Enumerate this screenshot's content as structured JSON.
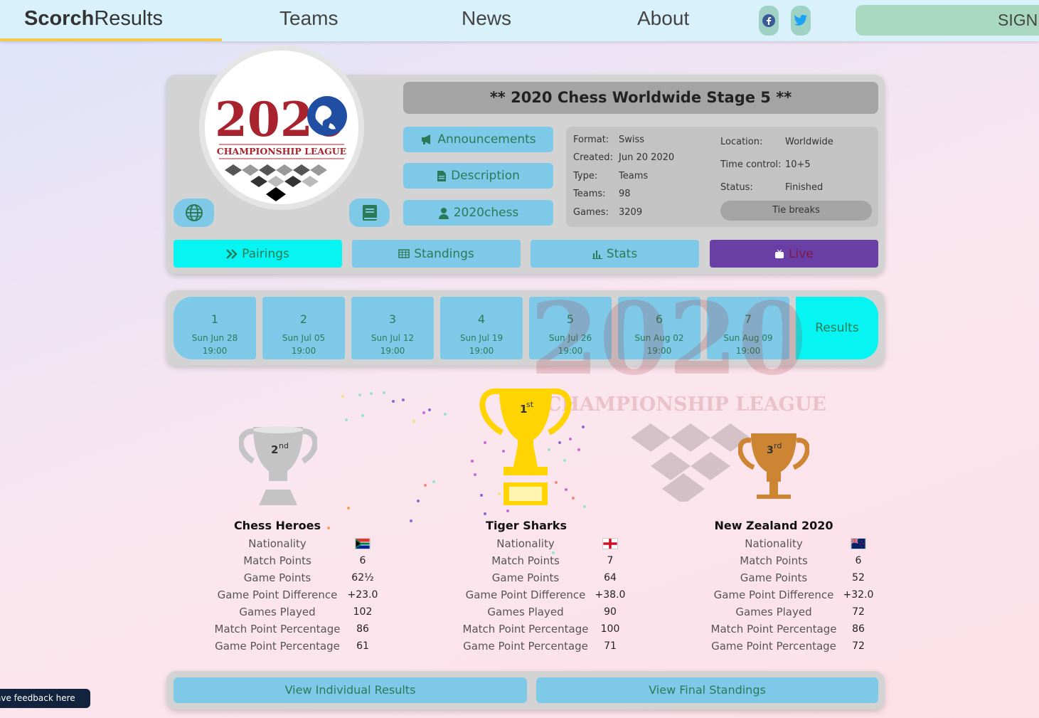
{
  "nav": {
    "brand_bold": "Scorch",
    "brand_light": "Results",
    "links": [
      "Teams",
      "News",
      "About"
    ],
    "signin": "SIGN"
  },
  "tournament": {
    "title": "** 2020 Chess Worldwide Stage 5 **",
    "logo_year": "2020",
    "logo_text": "CHAMPIONSHIP LEAGUE",
    "buttons": {
      "announcements": "Announcements",
      "description": "Description",
      "organizer": "2020chess"
    },
    "info_left": [
      {
        "label": "Format:",
        "value": "Swiss"
      },
      {
        "label": "Created:",
        "value": "Jun 20 2020"
      },
      {
        "label": "Type:",
        "value": "Teams"
      },
      {
        "label": "Teams:",
        "value": "98"
      },
      {
        "label": "Games:",
        "value": "3209"
      }
    ],
    "info_right": [
      {
        "label": "Location:",
        "value": "Worldwide"
      },
      {
        "label": "Time control:",
        "value": "10+5"
      },
      {
        "label": "Status:",
        "value": "Finished"
      }
    ],
    "tie_breaks": "Tie breaks"
  },
  "tabs": {
    "pairings": "Pairings",
    "standings": "Standings",
    "stats": "Stats",
    "live": "Live"
  },
  "rounds": [
    {
      "num": "1",
      "date": "Sun Jun 28",
      "time": "19:00"
    },
    {
      "num": "2",
      "date": "Sun Jul 05",
      "time": "19:00"
    },
    {
      "num": "3",
      "date": "Sun Jul 12",
      "time": "19:00"
    },
    {
      "num": "4",
      "date": "Sun Jul 19",
      "time": "19:00"
    },
    {
      "num": "5",
      "date": "Sun Jul 26",
      "time": "19:00"
    },
    {
      "num": "6",
      "date": "Sun Aug 02",
      "time": "19:00"
    },
    {
      "num": "7",
      "date": "Sun Aug 09",
      "time": "19:00"
    }
  ],
  "results_label": "Results",
  "stat_labels": [
    "Nationality",
    "Match Points",
    "Game Points",
    "Game Point Difference",
    "Games Played",
    "Match Point Percentage",
    "Game Point Percentage"
  ],
  "podium": {
    "second": {
      "place": "2",
      "suffix": "nd",
      "name": "Chess Heroes",
      "stats": [
        "6",
        "62½",
        "+23.0",
        "102",
        "86",
        "61"
      ]
    },
    "first": {
      "place": "1",
      "suffix": "st",
      "name": "Tiger Sharks",
      "stats": [
        "7",
        "64",
        "+38.0",
        "90",
        "100",
        "71"
      ]
    },
    "third": {
      "place": "3",
      "suffix": "rd",
      "name": "New Zealand 2020",
      "stats": [
        "6",
        "52",
        "+32.0",
        "72",
        "86",
        "72"
      ]
    }
  },
  "colors": {
    "gold": "#ffd400",
    "silver": "#c4c4c4",
    "bronze": "#cd8534",
    "accent_cyan": "#06f5f2",
    "button_blue": "#7ec9e8",
    "live_purple": "#6a3fa5"
  },
  "bottom": {
    "individual": "View Individual Results",
    "final": "View Final Standings"
  },
  "feedback": "ave feedback here"
}
